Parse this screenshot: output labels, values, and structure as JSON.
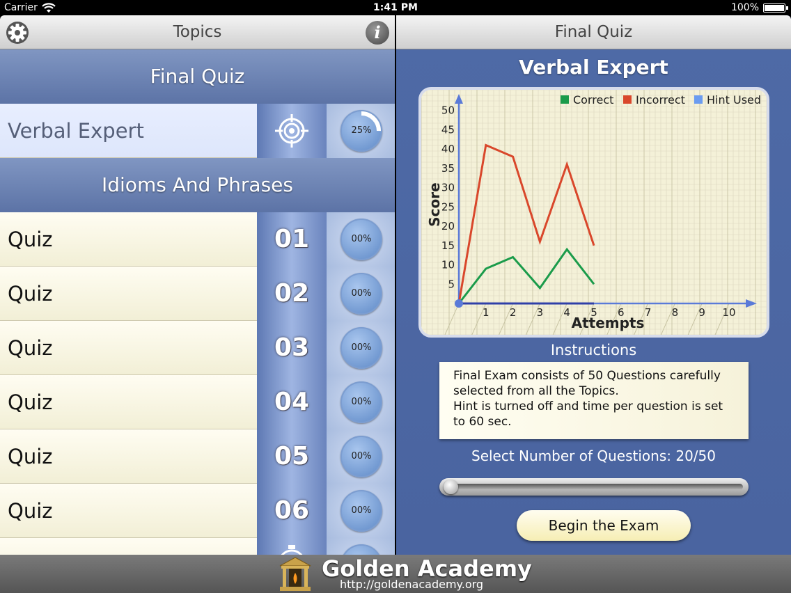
{
  "status_bar": {
    "carrier": "Carrier",
    "time": "1:41 PM",
    "battery": "100%"
  },
  "left_panel": {
    "title": "Topics",
    "sections": [
      {
        "header": "Final Quiz"
      },
      {
        "header": "Idioms And Phrases"
      }
    ],
    "verbal_row": {
      "label": "Verbal Expert",
      "progress": "25%",
      "progress_fraction": 0.25
    },
    "quiz_rows": [
      {
        "label": "Quiz",
        "number": "01",
        "progress": "00%"
      },
      {
        "label": "Quiz",
        "number": "02",
        "progress": "00%"
      },
      {
        "label": "Quiz",
        "number": "03",
        "progress": "00%"
      },
      {
        "label": "Quiz",
        "number": "04",
        "progress": "00%"
      },
      {
        "label": "Quiz",
        "number": "05",
        "progress": "00%"
      },
      {
        "label": "Quiz",
        "number": "06",
        "progress": "00%"
      }
    ]
  },
  "right_panel": {
    "title": "Final Quiz",
    "quiz_title": "Verbal Expert",
    "instructions_title": "Instructions",
    "instructions_text_1": "Final Exam consists of 50 Questions carefully selected from all the Topics.",
    "instructions_text_2": "Hint is turned off and time per question is set to 60 sec.",
    "select_label": "Select Number of Questions: 20/50",
    "slider_value": 20,
    "slider_max": 50,
    "begin_button": "Begin the Exam"
  },
  "footer": {
    "name": "Golden Academy",
    "url": "http://goldenacademy.org"
  },
  "colors": {
    "correct": "#1a9b4a",
    "incorrect": "#d9472b",
    "hint": "#6b9cf0",
    "axis": "#2f3fa8"
  },
  "chart_data": {
    "type": "line",
    "xlabel": "Attempts",
    "ylabel": "Score",
    "xlim": [
      0,
      10
    ],
    "ylim": [
      0,
      50
    ],
    "x_ticks": [
      "1",
      "2",
      "3",
      "4",
      "5",
      "6",
      "7",
      "8",
      "9",
      "10"
    ],
    "y_ticks": [
      "5",
      "10",
      "15",
      "20",
      "25",
      "30",
      "35",
      "40",
      "45",
      "50"
    ],
    "legend": [
      "Correct",
      "Incorrect",
      "Hint Used"
    ],
    "legend_position": "top-right",
    "grid": true,
    "series": [
      {
        "name": "Correct",
        "x": [
          0,
          1,
          2,
          3,
          4,
          5
        ],
        "values": [
          0,
          9,
          12,
          4,
          14,
          5
        ]
      },
      {
        "name": "Incorrect",
        "x": [
          0,
          1,
          2,
          3,
          4,
          5
        ],
        "values": [
          0,
          41,
          38,
          16,
          36,
          15
        ]
      },
      {
        "name": "Hint Used",
        "x": [
          0,
          1,
          2,
          3,
          4,
          5
        ],
        "values": [
          0,
          0,
          0,
          0,
          0,
          0
        ]
      }
    ]
  }
}
